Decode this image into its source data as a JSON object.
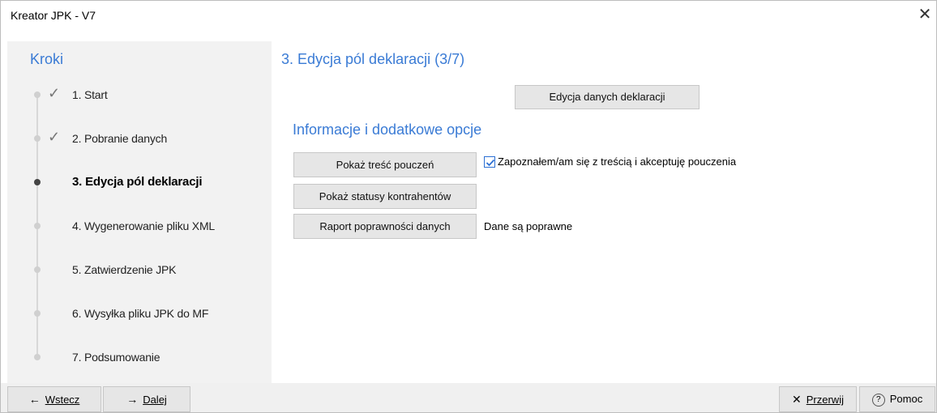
{
  "window": {
    "title": "Kreator JPK - V7",
    "close_symbol": "✕"
  },
  "sidebar": {
    "title": "Kroki",
    "steps": [
      {
        "label": "1. Start",
        "done": true,
        "active": false
      },
      {
        "label": "2. Pobranie danych",
        "done": true,
        "active": false
      },
      {
        "label": "3. Edycja pól deklaracji",
        "done": false,
        "active": true
      },
      {
        "label": "4. Wygenerowanie pliku XML",
        "done": false,
        "active": false
      },
      {
        "label": "5. Zatwierdzenie JPK",
        "done": false,
        "active": false
      },
      {
        "label": "6. Wysyłka pliku JPK do MF",
        "done": false,
        "active": false
      },
      {
        "label": "7. Podsumowanie",
        "done": false,
        "active": false
      }
    ],
    "check_symbol": "✓"
  },
  "main": {
    "title": "3. Edycja pól deklaracji (3/7)",
    "edit_button": "Edycja danych deklaracji",
    "section_title": "Informacje i dodatkowe opcje",
    "show_instructions_button": "Pokaż treść pouczeń",
    "acknowledge_checkbox": {
      "label": "Zapoznałem/am się z treścią i akceptuję pouczenia",
      "checked": true
    },
    "show_statuses_button": "Pokaż statusy kontrahentów",
    "validity_report_button": "Raport poprawności danych",
    "validity_status": "Dane są poprawne"
  },
  "footer": {
    "back": {
      "symbol": "←",
      "label": "Wstecz"
    },
    "next": {
      "symbol": "→",
      "label": "Dalej"
    },
    "abort": {
      "symbol": "✕",
      "label": "Przerwij"
    },
    "help": {
      "symbol": "?",
      "label": "Pomoc"
    }
  },
  "colors": {
    "accent": "#3a7bd5",
    "sidebar_bg": "#f2f2f2",
    "button_bg": "#e6e6e6"
  }
}
